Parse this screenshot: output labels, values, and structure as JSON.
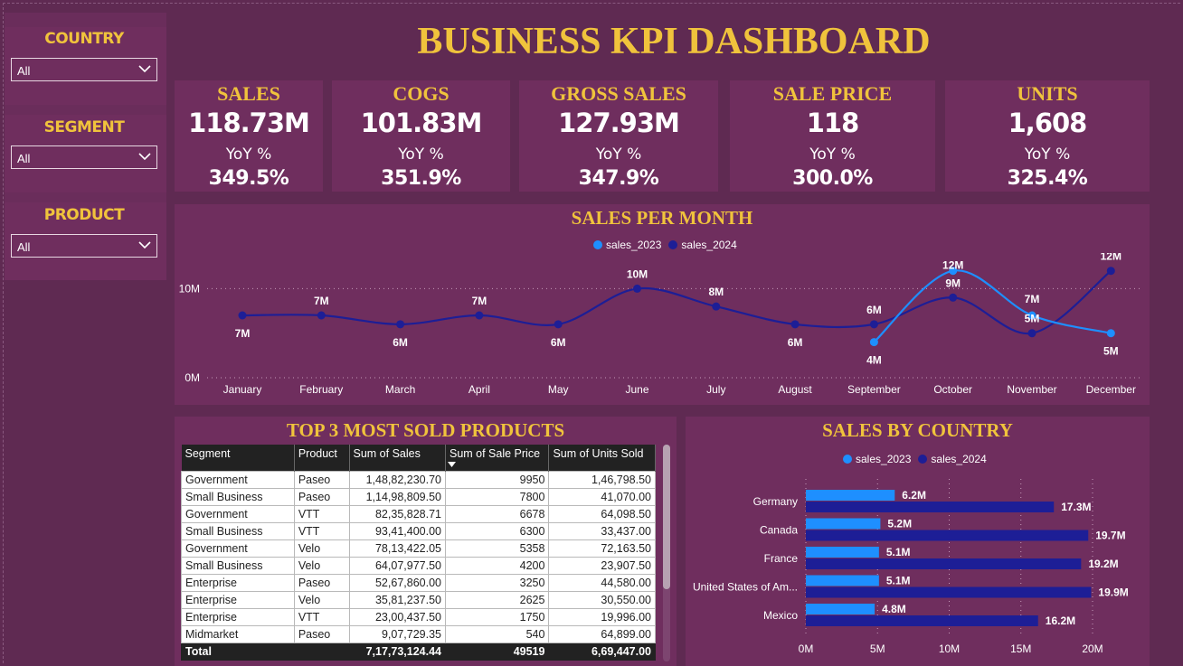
{
  "title": "BUSINESS KPI DASHBOARD",
  "filters": [
    {
      "label": "COUNTRY",
      "value": "All"
    },
    {
      "label": "SEGMENT",
      "value": "All"
    },
    {
      "label": "PRODUCT",
      "value": "All"
    }
  ],
  "kpis": [
    {
      "label": "SALES",
      "value": "118.73M",
      "yoy_label": "YoY %",
      "yoy": "349.5%"
    },
    {
      "label": "COGS",
      "value": "101.83M",
      "yoy_label": "YoY %",
      "yoy": "351.9%"
    },
    {
      "label": "GROSS SALES",
      "value": "127.93M",
      "yoy_label": "YoY %",
      "yoy": "347.9%"
    },
    {
      "label": "SALE PRICE",
      "value": "118",
      "yoy_label": "YoY %",
      "yoy": "300.0%"
    },
    {
      "label": "UNITS",
      "value": "1,608",
      "yoy_label": "YoY %",
      "yoy": "325.4%"
    }
  ],
  "colors": {
    "s2023": "#1e8fff",
    "s2024": "#1d1e96",
    "accent": "#f0c33c"
  },
  "chart_data": [
    {
      "type": "line",
      "title": "SALES PER MONTH",
      "categories": [
        "January",
        "February",
        "March",
        "April",
        "May",
        "June",
        "July",
        "August",
        "September",
        "October",
        "November",
        "December"
      ],
      "series": [
        {
          "name": "sales_2023",
          "values": [
            null,
            null,
            null,
            null,
            null,
            null,
            null,
            null,
            4,
            12,
            7,
            5
          ],
          "labels": [
            "",
            "",
            "",
            "",
            "",
            "",
            "",
            "",
            "4M",
            "12M",
            "7M",
            "5M"
          ]
        },
        {
          "name": "sales_2024",
          "values": [
            7,
            7,
            6,
            7,
            6,
            10,
            8,
            6,
            6,
            9,
            5,
            12
          ],
          "labels": [
            "7M",
            "7M",
            "6M",
            "7M",
            "6M",
            "10M",
            "8M",
            "6M",
            "6M",
            "9M",
            "5M",
            "12M"
          ]
        }
      ],
      "y_ticks": [
        "0M",
        "10M"
      ],
      "ylim": [
        0,
        14
      ],
      "legend": "top-center"
    },
    {
      "type": "bar",
      "title": "SALES BY COUNTRY",
      "categories": [
        "Germany",
        "Canada",
        "France",
        "United States of Am...",
        "Mexico"
      ],
      "series": [
        {
          "name": "sales_2023",
          "values": [
            6.2,
            5.2,
            5.1,
            5.1,
            4.8
          ],
          "labels": [
            "6.2M",
            "5.2M",
            "5.1M",
            "5.1M",
            "4.8M"
          ]
        },
        {
          "name": "sales_2024",
          "values": [
            17.3,
            19.7,
            19.2,
            19.9,
            16.2
          ],
          "labels": [
            "17.3M",
            "19.7M",
            "19.2M",
            "19.9M",
            "16.2M"
          ]
        }
      ],
      "x_ticks": [
        "0M",
        "5M",
        "10M",
        "15M",
        "20M"
      ],
      "xlim": [
        0,
        20
      ],
      "legend": "top-center",
      "orientation": "horizontal"
    }
  ],
  "table": {
    "title": "TOP 3 MOST SOLD PRODUCTS",
    "columns": [
      "Segment",
      "Product",
      "Sum of Sales",
      "Sum of Sale Price",
      "Sum of Units Sold"
    ],
    "rows": [
      [
        "Government",
        "Paseo",
        "1,48,82,230.70",
        "9950",
        "1,46,798.50"
      ],
      [
        "Small Business",
        "Paseo",
        "1,14,98,809.50",
        "7800",
        "41,070.00"
      ],
      [
        "Government",
        "VTT",
        "82,35,828.71",
        "6678",
        "64,098.50"
      ],
      [
        "Small Business",
        "VTT",
        "93,41,400.00",
        "6300",
        "33,437.00"
      ],
      [
        "Government",
        "Velo",
        "78,13,422.05",
        "5358",
        "72,163.50"
      ],
      [
        "Small Business",
        "Velo",
        "64,07,977.50",
        "4200",
        "23,907.50"
      ],
      [
        "Enterprise",
        "Paseo",
        "52,67,860.00",
        "3250",
        "44,580.00"
      ],
      [
        "Enterprise",
        "Velo",
        "35,81,237.50",
        "2625",
        "30,550.00"
      ],
      [
        "Enterprise",
        "VTT",
        "23,00,437.50",
        "1750",
        "19,996.00"
      ],
      [
        "Midmarket",
        "Paseo",
        "9,07,729.35",
        "540",
        "64,899.00"
      ]
    ],
    "total": [
      "Total",
      "",
      "7,17,73,124.44",
      "49519",
      "6,69,447.00"
    ]
  }
}
